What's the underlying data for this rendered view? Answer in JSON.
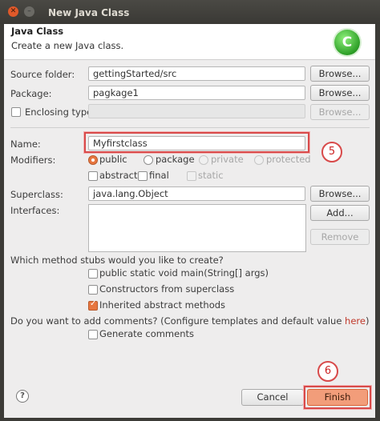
{
  "window": {
    "title": "New Java Class"
  },
  "banner": {
    "title": "Java Class",
    "description": "Create a new Java class.",
    "logo_glyph": "C"
  },
  "fields": {
    "source_folder": {
      "label": "Source folder:",
      "value": "gettingStarted/src",
      "browse": "Browse..."
    },
    "package": {
      "label": "Package:",
      "value": "pagkage1",
      "browse": "Browse..."
    },
    "enclosing": {
      "label": "Enclosing type:",
      "value": "",
      "browse": "Browse..."
    },
    "name": {
      "label": "Name:",
      "value": "Myfirstclass"
    },
    "superclass": {
      "label": "Superclass:",
      "value": "java.lang.Object",
      "browse": "Browse..."
    },
    "interfaces": {
      "label": "Interfaces:",
      "add": "Add...",
      "remove": "Remove"
    }
  },
  "modifiers": {
    "label": "Modifiers:",
    "access": [
      "public",
      "package",
      "private",
      "protected"
    ],
    "access_selected": "public",
    "flags": [
      "abstract",
      "final",
      "static"
    ]
  },
  "stubs": {
    "question": "Which method stubs would you like to create?",
    "options": [
      {
        "label": "public static void main(String[] args)",
        "checked": false
      },
      {
        "label": "Constructors from superclass",
        "checked": false
      },
      {
        "label": "Inherited abstract methods",
        "checked": true
      }
    ]
  },
  "comments": {
    "question_prefix": "Do you want to add comments? (Configure templates and default value ",
    "link": "here",
    "question_suffix": ")",
    "option": "Generate comments"
  },
  "annotations": {
    "step5": "5",
    "step6": "6"
  },
  "footer": {
    "help_glyph": "?",
    "cancel": "Cancel",
    "finish": "Finish"
  },
  "colors": {
    "accent": "#e7763f",
    "highlight": "#d84a4a",
    "titlebar": "#3c3b37"
  }
}
